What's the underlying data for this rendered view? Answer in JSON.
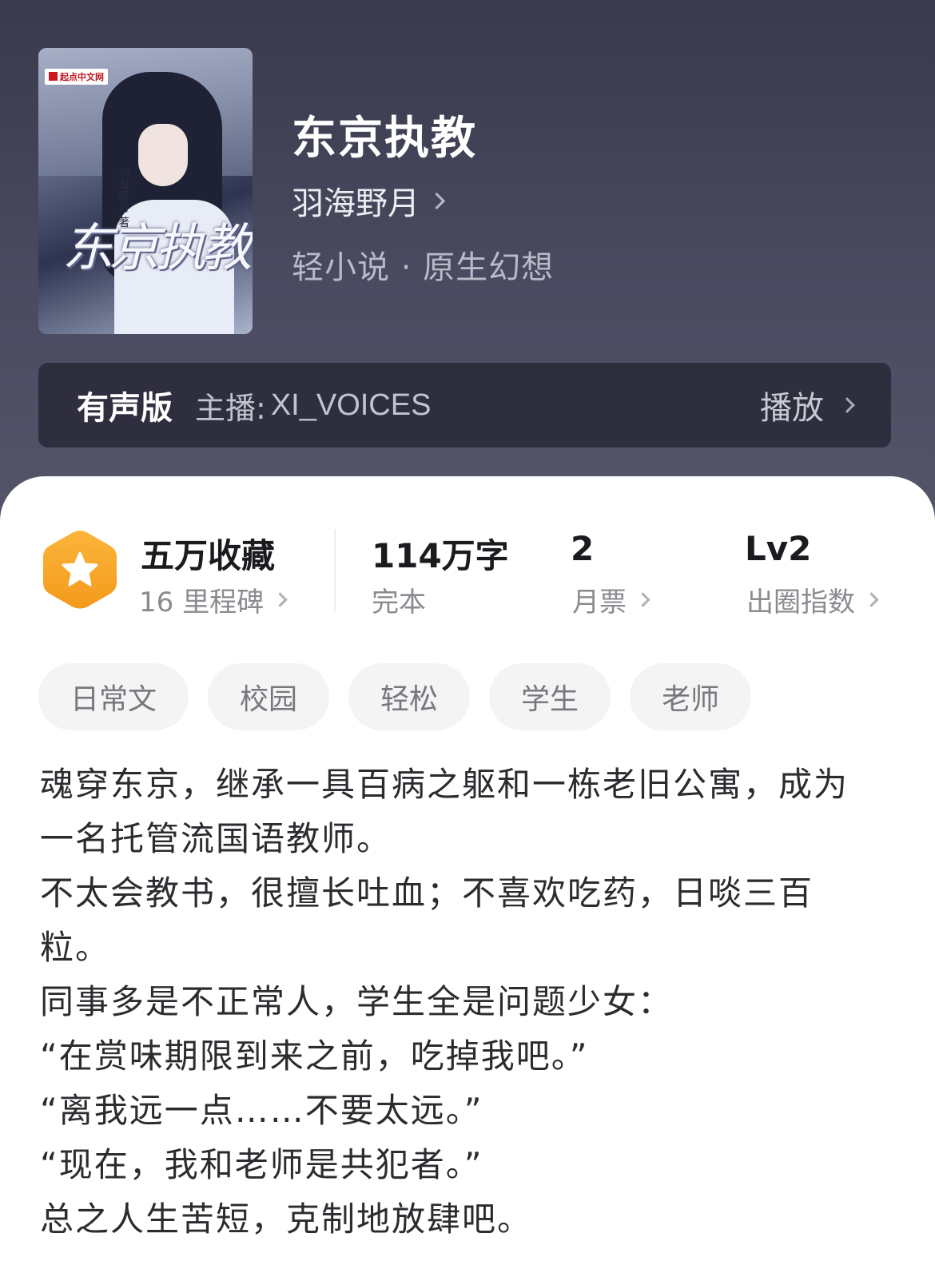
{
  "book": {
    "title": "东京执教",
    "author": "羽海野月",
    "genre": "轻小说 · 原生幻想",
    "cover": {
      "publisher_logo": "起点中文网",
      "title_art": "东京执教",
      "author_art": "羽海野月 著"
    }
  },
  "audio": {
    "tag": "有声版",
    "host_label": "主播:",
    "host": "XI_VOICES",
    "play_label": "播放"
  },
  "stats": {
    "favorites": {
      "main": "五万收藏",
      "sub": "16 里程碑"
    },
    "words": {
      "main": "114万字",
      "sub": "完本"
    },
    "tickets": {
      "main": "2",
      "sub": "月票"
    },
    "level": {
      "main": "Lv2",
      "sub": "出圈指数"
    }
  },
  "tags": [
    "日常文",
    "校园",
    "轻松",
    "学生",
    "老师"
  ],
  "synopsis": [
    "魂穿东京，继承一具百病之躯和一栋老旧公寓，成为",
    "一名托管流国语教师。",
    "不太会教书，很擅长吐血；不喜欢吃药，日啖三百",
    "粒。",
    "同事多是不正常人，学生全是问题少女：",
    "“在赏味期限到来之前，吃掉我吧。”",
    "“离我远一点……不要太远。”",
    "“现在，我和老师是共犯者。”",
    "总之人生苦短，克制地放肆吧。"
  ],
  "icons": {
    "badge": "star-hexagon-icon",
    "chevron": "chevron-right-icon"
  },
  "colors": {
    "hero_bg": "#3a3a4e",
    "audio_bar": "#2e2e3e",
    "badge_orange": "#f5a623",
    "tag_bg": "#f4f4f5"
  }
}
